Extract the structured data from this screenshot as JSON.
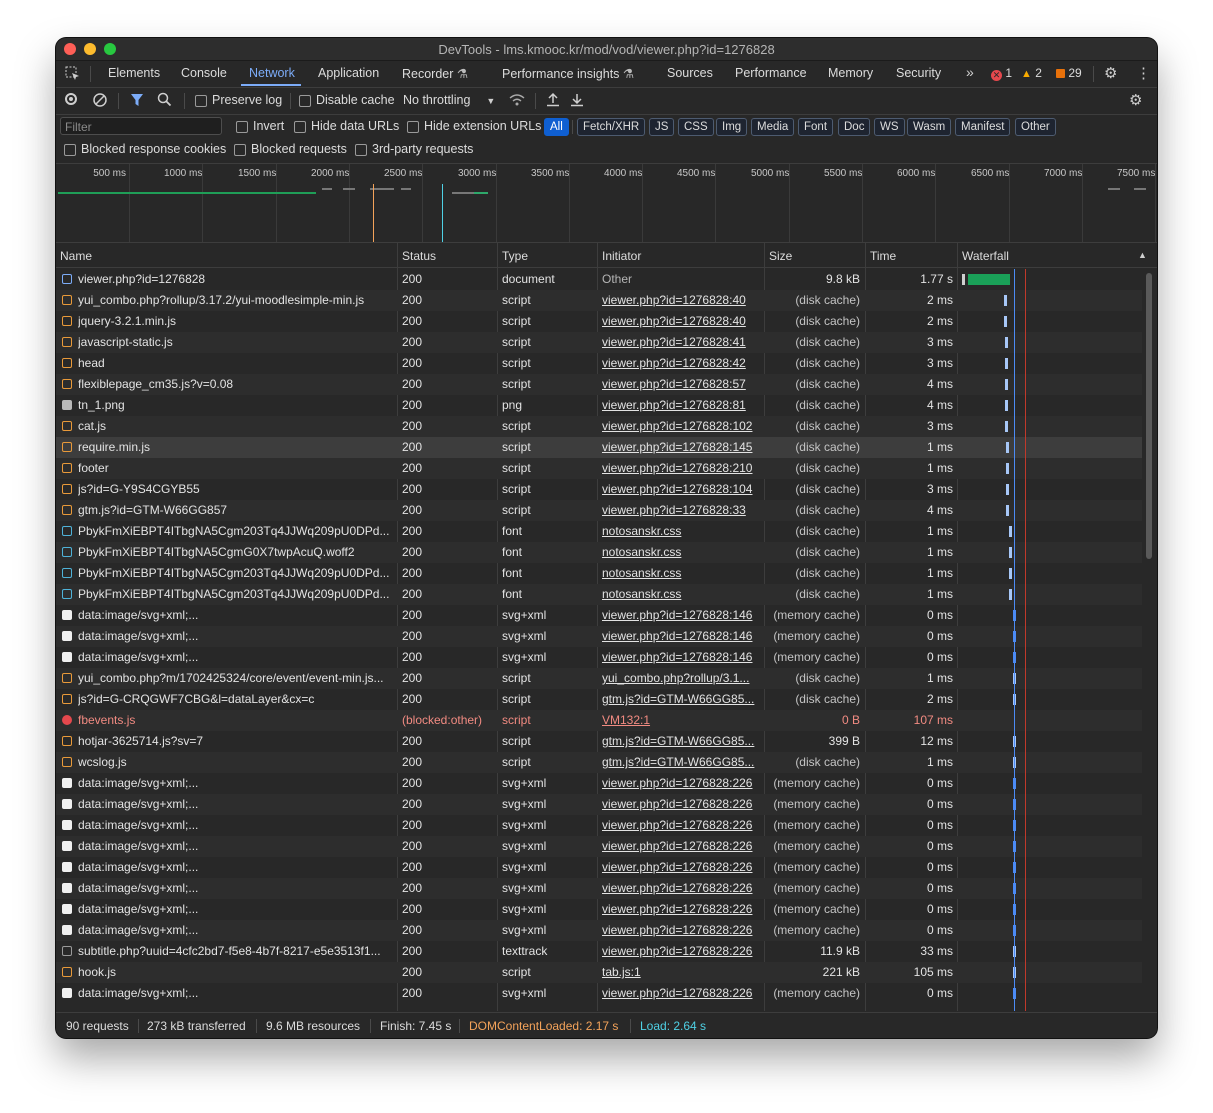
{
  "window": {
    "title": "DevTools - lms.kmooc.kr/mod/vod/viewer.php?id=1276828"
  },
  "tabs": [
    "Elements",
    "Console",
    "Network",
    "Application",
    "Recorder",
    "Performance insights",
    "Sources",
    "Performance",
    "Memory",
    "Security"
  ],
  "active_tab": "Network",
  "badges": {
    "errors": "1",
    "warnings": "2",
    "issues": "29"
  },
  "toolbar": {
    "preserve_log": "Preserve log",
    "disable_cache": "Disable cache",
    "throttling": "No throttling"
  },
  "filter": {
    "placeholder": "Filter",
    "invert": "Invert",
    "hide_data_urls": "Hide data URLs",
    "hide_extension_urls": "Hide extension URLs",
    "types": [
      "All",
      "Fetch/XHR",
      "JS",
      "CSS",
      "Img",
      "Media",
      "Font",
      "Doc",
      "WS",
      "Wasm",
      "Manifest",
      "Other"
    ],
    "blocked_response_cookies": "Blocked response cookies",
    "blocked_requests": "Blocked requests",
    "third_party": "3rd-party requests"
  },
  "overview_ticks": [
    "500 ms",
    "1000 ms",
    "1500 ms",
    "2000 ms",
    "2500 ms",
    "3000 ms",
    "3500 ms",
    "4000 ms",
    "4500 ms",
    "5000 ms",
    "5500 ms",
    "6000 ms",
    "6500 ms",
    "7000 ms",
    "7500 ms"
  ],
  "columns": {
    "name": "Name",
    "status": "Status",
    "type": "Type",
    "initiator": "Initiator",
    "size": "Size",
    "time": "Time",
    "waterfall": "Waterfall"
  },
  "requests": [
    {
      "name": "viewer.php?id=1276828",
      "status": "200",
      "type": "document",
      "initiator": "Other",
      "size": "9.8 kB",
      "time": "1.77 s",
      "icon": "doc"
    },
    {
      "name": "yui_combo.php?rollup/3.17.2/yui-moodlesimple-min.js",
      "status": "200",
      "type": "script",
      "initiator": "viewer.php?id=1276828:40",
      "size": "(disk cache)",
      "time": "2 ms",
      "icon": "script"
    },
    {
      "name": "jquery-3.2.1.min.js",
      "status": "200",
      "type": "script",
      "initiator": "viewer.php?id=1276828:40",
      "size": "(disk cache)",
      "time": "2 ms",
      "icon": "script"
    },
    {
      "name": "javascript-static.js",
      "status": "200",
      "type": "script",
      "initiator": "viewer.php?id=1276828:41",
      "size": "(disk cache)",
      "time": "3 ms",
      "icon": "script"
    },
    {
      "name": "head",
      "status": "200",
      "type": "script",
      "initiator": "viewer.php?id=1276828:42",
      "size": "(disk cache)",
      "time": "3 ms",
      "icon": "script"
    },
    {
      "name": "flexiblepage_cm35.js?v=0.08",
      "status": "200",
      "type": "script",
      "initiator": "viewer.php?id=1276828:57",
      "size": "(disk cache)",
      "time": "4 ms",
      "icon": "script"
    },
    {
      "name": "tn_1.png",
      "status": "200",
      "type": "png",
      "initiator": "viewer.php?id=1276828:81",
      "size": "(disk cache)",
      "time": "4 ms",
      "icon": "png"
    },
    {
      "name": "cat.js",
      "status": "200",
      "type": "script",
      "initiator": "viewer.php?id=1276828:102",
      "size": "(disk cache)",
      "time": "3 ms",
      "icon": "script"
    },
    {
      "name": "require.min.js",
      "status": "200",
      "type": "script",
      "initiator": "viewer.php?id=1276828:145",
      "size": "(disk cache)",
      "time": "1 ms",
      "icon": "script",
      "selected": true
    },
    {
      "name": "footer",
      "status": "200",
      "type": "script",
      "initiator": "viewer.php?id=1276828:210",
      "size": "(disk cache)",
      "time": "1 ms",
      "icon": "script"
    },
    {
      "name": "js?id=G-Y9S4CGYB55",
      "status": "200",
      "type": "script",
      "initiator": "viewer.php?id=1276828:104",
      "size": "(disk cache)",
      "time": "3 ms",
      "icon": "script"
    },
    {
      "name": "gtm.js?id=GTM-W66GG857",
      "status": "200",
      "type": "script",
      "initiator": "viewer.php?id=1276828:33",
      "size": "(disk cache)",
      "time": "4 ms",
      "icon": "script"
    },
    {
      "name": "PbykFmXiEBPT4ITbgNA5Cgm203Tq4JJWq209pU0DPd...",
      "status": "200",
      "type": "font",
      "initiator": "notosanskr.css",
      "size": "(disk cache)",
      "time": "1 ms",
      "icon": "font"
    },
    {
      "name": "PbykFmXiEBPT4ITbgNA5CgmG0X7twpAcuQ.woff2",
      "status": "200",
      "type": "font",
      "initiator": "notosanskr.css",
      "size": "(disk cache)",
      "time": "1 ms",
      "icon": "font"
    },
    {
      "name": "PbykFmXiEBPT4ITbgNA5Cgm203Tq4JJWq209pU0DPd...",
      "status": "200",
      "type": "font",
      "initiator": "notosanskr.css",
      "size": "(disk cache)",
      "time": "1 ms",
      "icon": "font"
    },
    {
      "name": "PbykFmXiEBPT4ITbgNA5Cgm203Tq4JJWq209pU0DPd...",
      "status": "200",
      "type": "font",
      "initiator": "notosanskr.css",
      "size": "(disk cache)",
      "time": "1 ms",
      "icon": "font"
    },
    {
      "name": "data:image/svg+xml;...",
      "status": "200",
      "type": "svg+xml",
      "initiator": "viewer.php?id=1276828:146",
      "size": "(memory cache)",
      "time": "0 ms",
      "icon": "img"
    },
    {
      "name": "data:image/svg+xml;...",
      "status": "200",
      "type": "svg+xml",
      "initiator": "viewer.php?id=1276828:146",
      "size": "(memory cache)",
      "time": "0 ms",
      "icon": "img"
    },
    {
      "name": "data:image/svg+xml;...",
      "status": "200",
      "type": "svg+xml",
      "initiator": "viewer.php?id=1276828:146",
      "size": "(memory cache)",
      "time": "0 ms",
      "icon": "img"
    },
    {
      "name": "yui_combo.php?m/1702425324/core/event/event-min.js...",
      "status": "200",
      "type": "script",
      "initiator": "yui_combo.php?rollup/3.1...",
      "size": "(disk cache)",
      "time": "1 ms",
      "icon": "script"
    },
    {
      "name": "js?id=G-CRQGWF7CBG&l=dataLayer&cx=c",
      "status": "200",
      "type": "script",
      "initiator": "gtm.js?id=GTM-W66GG85...",
      "size": "(disk cache)",
      "time": "2 ms",
      "icon": "script"
    },
    {
      "name": "fbevents.js",
      "status": "(blocked:other)",
      "type": "script",
      "initiator": "VM132:1",
      "size": "0 B",
      "time": "107 ms",
      "icon": "err",
      "error": true
    },
    {
      "name": "hotjar-3625714.js?sv=7",
      "status": "200",
      "type": "script",
      "initiator": "gtm.js?id=GTM-W66GG85...",
      "size": "399 B",
      "time": "12 ms",
      "icon": "script"
    },
    {
      "name": "wcslog.js",
      "status": "200",
      "type": "script",
      "initiator": "gtm.js?id=GTM-W66GG85...",
      "size": "(disk cache)",
      "time": "1 ms",
      "icon": "script"
    },
    {
      "name": "data:image/svg+xml;...",
      "status": "200",
      "type": "svg+xml",
      "initiator": "viewer.php?id=1276828:226",
      "size": "(memory cache)",
      "time": "0 ms",
      "icon": "img"
    },
    {
      "name": "data:image/svg+xml;...",
      "status": "200",
      "type": "svg+xml",
      "initiator": "viewer.php?id=1276828:226",
      "size": "(memory cache)",
      "time": "0 ms",
      "icon": "img"
    },
    {
      "name": "data:image/svg+xml;...",
      "status": "200",
      "type": "svg+xml",
      "initiator": "viewer.php?id=1276828:226",
      "size": "(memory cache)",
      "time": "0 ms",
      "icon": "img"
    },
    {
      "name": "data:image/svg+xml;...",
      "status": "200",
      "type": "svg+xml",
      "initiator": "viewer.php?id=1276828:226",
      "size": "(memory cache)",
      "time": "0 ms",
      "icon": "img"
    },
    {
      "name": "data:image/svg+xml;...",
      "status": "200",
      "type": "svg+xml",
      "initiator": "viewer.php?id=1276828:226",
      "size": "(memory cache)",
      "time": "0 ms",
      "icon": "img"
    },
    {
      "name": "data:image/svg+xml;...",
      "status": "200",
      "type": "svg+xml",
      "initiator": "viewer.php?id=1276828:226",
      "size": "(memory cache)",
      "time": "0 ms",
      "icon": "img"
    },
    {
      "name": "data:image/svg+xml;...",
      "status": "200",
      "type": "svg+xml",
      "initiator": "viewer.php?id=1276828:226",
      "size": "(memory cache)",
      "time": "0 ms",
      "icon": "img"
    },
    {
      "name": "data:image/svg+xml;...",
      "status": "200",
      "type": "svg+xml",
      "initiator": "viewer.php?id=1276828:226",
      "size": "(memory cache)",
      "time": "0 ms",
      "icon": "img"
    },
    {
      "name": "subtitle.php?uuid=4cfc2bd7-f5e8-4b7f-8217-e5e3513f1...",
      "status": "200",
      "type": "texttrack",
      "initiator": "viewer.php?id=1276828:226",
      "size": "11.9 kB",
      "time": "33 ms",
      "icon": "track"
    },
    {
      "name": "hook.js",
      "status": "200",
      "type": "script",
      "initiator": "tab.js:1",
      "size": "221 kB",
      "time": "105 ms",
      "icon": "script"
    },
    {
      "name": "data:image/svg+xml;...",
      "status": "200",
      "type": "svg+xml",
      "initiator": "viewer.php?id=1276828:226",
      "size": "(memory cache)",
      "time": "0 ms",
      "icon": "img"
    }
  ],
  "statusbar": {
    "requests": "90 requests",
    "transferred": "273 kB transferred",
    "resources": "9.6 MB resources",
    "finish": "Finish: 7.45 s",
    "dom_content_loaded": "DOMContentLoaded: 2.17 s",
    "load": "Load: 2.64 s"
  },
  "colors": {
    "accent": "#7cacf8",
    "dcl": "#f4a35a",
    "load": "#4fd1e5",
    "error": "#f28b82"
  }
}
